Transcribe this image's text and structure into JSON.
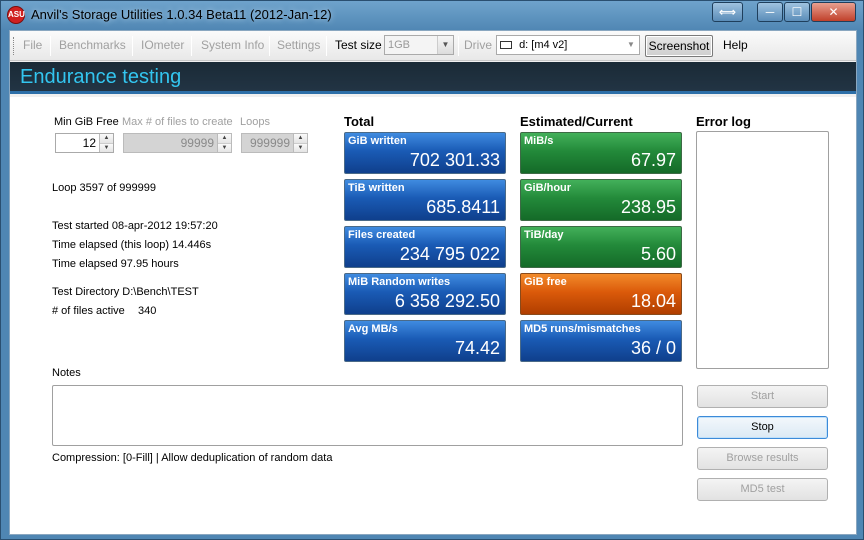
{
  "window": {
    "title": "Anvil's Storage Utilities 1.0.34 Beta11 (2012-Jan-12)",
    "icon_name": "anvil-app-icon",
    "icon_text": "ASU",
    "controls": {
      "restore_size": "⟺",
      "minimize": "─",
      "maximize": "☐",
      "close": "✕"
    }
  },
  "toolbar": {
    "file": "File",
    "benchmarks": "Benchmarks",
    "iometer": "IOmeter",
    "system_info": "System Info",
    "settings": "Settings",
    "test_size_label": "Test size",
    "test_size_value": "1GB",
    "drive_label": "Drive",
    "drive_value": "d: [m4 v2]",
    "screenshot": "Screenshot",
    "help": "Help"
  },
  "banner": {
    "title": "Endurance testing"
  },
  "params": {
    "min_gib_free_label": "Min GiB Free",
    "min_gib_free_value": "12",
    "max_files_label": "Max # of files to create",
    "max_files_value": "99999",
    "loops_label": "Loops",
    "loops_value": "999999"
  },
  "info": {
    "loop": "Loop 3597 of 999999",
    "test_started": "Test started 08-apr-2012 19:57:20",
    "elapsed_loop": "Time elapsed (this loop) 14.446s",
    "elapsed_total": "Time elapsed 97.95 hours",
    "test_directory": "Test Directory D:\\Bench\\TEST",
    "files_active_label": "# of files active",
    "files_active_value": "340"
  },
  "totals": {
    "heading": "Total",
    "tiles": [
      {
        "label": "GiB written",
        "value": "702 301.33"
      },
      {
        "label": "TiB written",
        "value": "685.8411"
      },
      {
        "label": "Files created",
        "value": "234 795 022"
      },
      {
        "label": "MiB Random writes",
        "value": "6 358 292.50"
      },
      {
        "label": "Avg MB/s",
        "value": "74.42"
      }
    ]
  },
  "estimated": {
    "heading": "Estimated/Current",
    "tiles": [
      {
        "label": "MiB/s",
        "value": "67.97",
        "color": "green"
      },
      {
        "label": "GiB/hour",
        "value": "238.95",
        "color": "green"
      },
      {
        "label": "TiB/day",
        "value": "5.60",
        "color": "green"
      },
      {
        "label": "GiB free",
        "value": "18.04",
        "color": "orange"
      },
      {
        "label": "MD5 runs/mismatches",
        "value": "36 / 0",
        "color": "blue"
      }
    ]
  },
  "error_log": {
    "heading": "Error log"
  },
  "notes": {
    "label": "Notes"
  },
  "compression": "Compression: [0-Fill] | Allow deduplication of random data",
  "buttons": {
    "start": "Start",
    "stop": "Stop",
    "browse_results": "Browse results",
    "md5_test": "MD5 test"
  },
  "colors": {
    "banner_text": "#33c5ef",
    "tile_blue": "#1a5bb5",
    "tile_green": "#238a3a",
    "tile_orange": "#db5a0a"
  }
}
